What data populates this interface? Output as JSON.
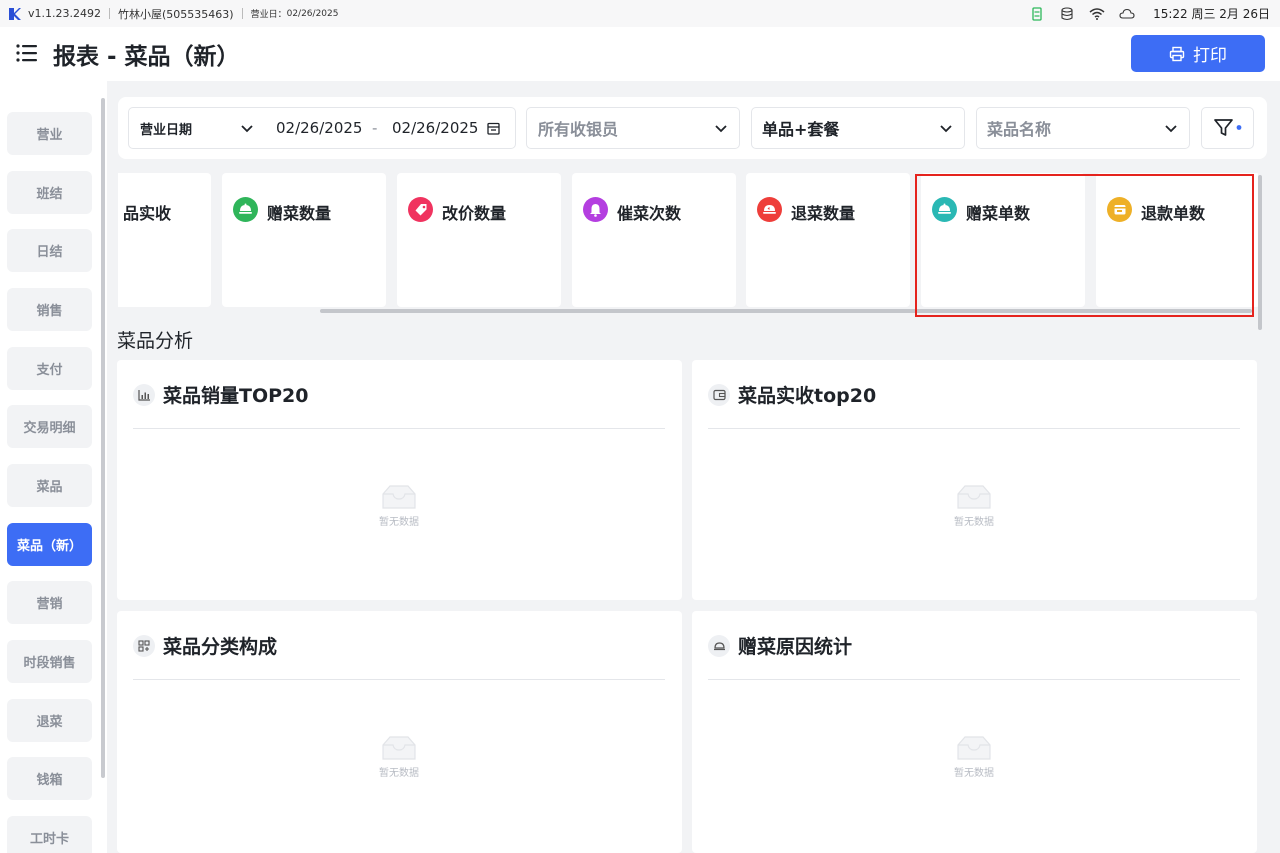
{
  "statusbar": {
    "version": "v1.1.23.2492",
    "store": "竹林小屋(505535463)",
    "business_day_label": "营业日：",
    "business_day": "02/26/2025",
    "clock": "15:22 周三 2月 26日",
    "icons": [
      "battery-icon",
      "database-icon",
      "wifi-icon",
      "cloud-icon"
    ]
  },
  "header": {
    "title": "报表 - 菜品（新）",
    "print_label": "打印"
  },
  "sidebar": {
    "items": [
      {
        "label": "营业"
      },
      {
        "label": "班结"
      },
      {
        "label": "日结"
      },
      {
        "label": "销售"
      },
      {
        "label": "支付"
      },
      {
        "label": "交易明细"
      },
      {
        "label": "菜品"
      },
      {
        "label": "菜品（新）",
        "active": true
      },
      {
        "label": "营销"
      },
      {
        "label": "时段销售"
      },
      {
        "label": "退菜"
      },
      {
        "label": "钱箱"
      },
      {
        "label": "工时卡"
      }
    ]
  },
  "filters": {
    "date_type": "营业日期",
    "date_start": "02/26/2025",
    "date_sep": "-",
    "date_end": "02/26/2025",
    "cashier": "所有收银员",
    "item_type": "单品+套餐",
    "dish_name": "菜品名称"
  },
  "cards": [
    {
      "label": "品实收",
      "icon": "none"
    },
    {
      "label": "赠菜数量",
      "icon": "gift-dish-icon",
      "color": "#2fb55a"
    },
    {
      "label": "改价数量",
      "icon": "price-tag-icon",
      "color": "#f0335f"
    },
    {
      "label": "催菜次数",
      "icon": "bell-icon",
      "color": "#b43ee0"
    },
    {
      "label": "退菜数量",
      "icon": "return-dish-icon",
      "color": "#ee3e3a"
    },
    {
      "label": "赠菜单数",
      "icon": "gift-order-icon",
      "color": "#2ab8b4"
    },
    {
      "label": "退款单数",
      "icon": "refund-icon",
      "color": "#eeb027"
    }
  ],
  "section_title": "菜品分析",
  "panels": [
    {
      "title": "菜品销量TOP20",
      "icon": "bar-chart-icon",
      "empty": "暂无数据"
    },
    {
      "title": "菜品实收top20",
      "icon": "wallet-icon",
      "empty": "暂无数据"
    },
    {
      "title": "菜品分类构成",
      "icon": "category-grid-icon",
      "empty": "暂无数据"
    },
    {
      "title": "赠菜原因统计",
      "icon": "dish-cover-icon",
      "empty": "暂无数据"
    }
  ],
  "colors": {
    "primary": "#3d6df5",
    "highlight_border": "#e5231d"
  }
}
